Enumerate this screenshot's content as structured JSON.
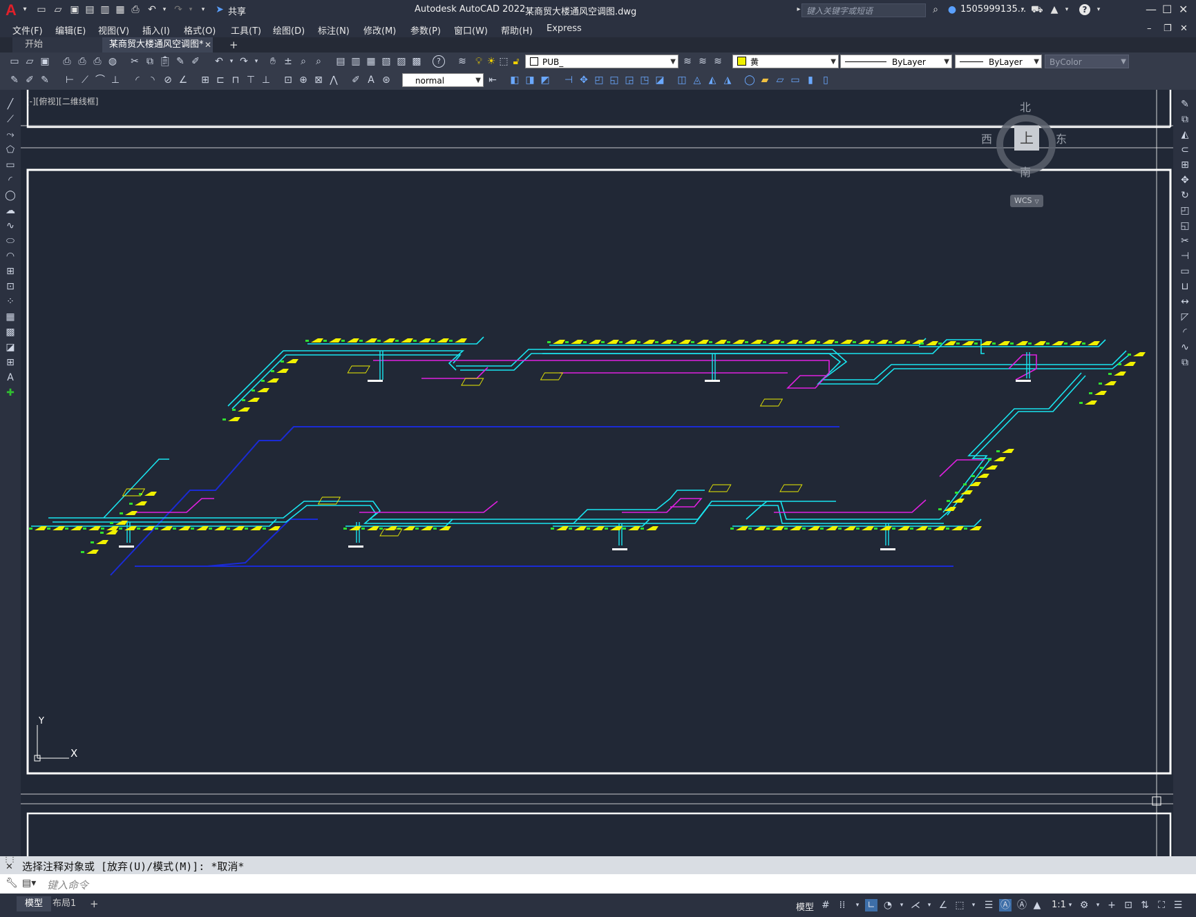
{
  "titlebar": {
    "logo": "A",
    "app_title": "Autodesk AutoCAD 2022",
    "file_title": "某商贸大楼通风空调图.dwg",
    "share_label": "共享",
    "search_placeholder": "键入关键字或短语",
    "user_name": "1505999135...",
    "help": "?"
  },
  "menu": [
    "文件(F)",
    "编辑(E)",
    "视图(V)",
    "插入(I)",
    "格式(O)",
    "工具(T)",
    "绘图(D)",
    "标注(N)",
    "修改(M)",
    "参数(P)",
    "窗口(W)",
    "帮助(H)",
    "Express"
  ],
  "tabs": {
    "start": "开始",
    "drawing": "某商贸大楼通风空调图*",
    "close": "✕",
    "add": "+"
  },
  "toolbar": {
    "layer_name": "PUB_",
    "color_name": "黄",
    "linetype": "ByLayer",
    "lineweight": "ByLayer",
    "plotstyle": "ByColor",
    "textstyle": "normal"
  },
  "viewport": {
    "label": "[-][俯视][二维线框]"
  },
  "viewcube": {
    "north": "北",
    "south": "南",
    "east": "东",
    "west": "西",
    "top": "上",
    "wcs": "WCS"
  },
  "ucs": {
    "y": "Y",
    "x": "X"
  },
  "command": {
    "history": "选择注释对象或 [放弃(U)/模式(M)]: *取消*",
    "placeholder": "键入命令"
  },
  "status": {
    "model_tab": "模型",
    "layout_tab": "布局1",
    "add": "+",
    "model_btn": "模型",
    "scale": "1:1"
  },
  "colors": {
    "bg": "#212836",
    "frame": "#ffffff",
    "duct_cyan": "#19e6f0",
    "duct_magenta": "#e020e0",
    "duct_blue": "#1a2bd6",
    "yellow": "#f0f000",
    "green": "#30e030"
  }
}
